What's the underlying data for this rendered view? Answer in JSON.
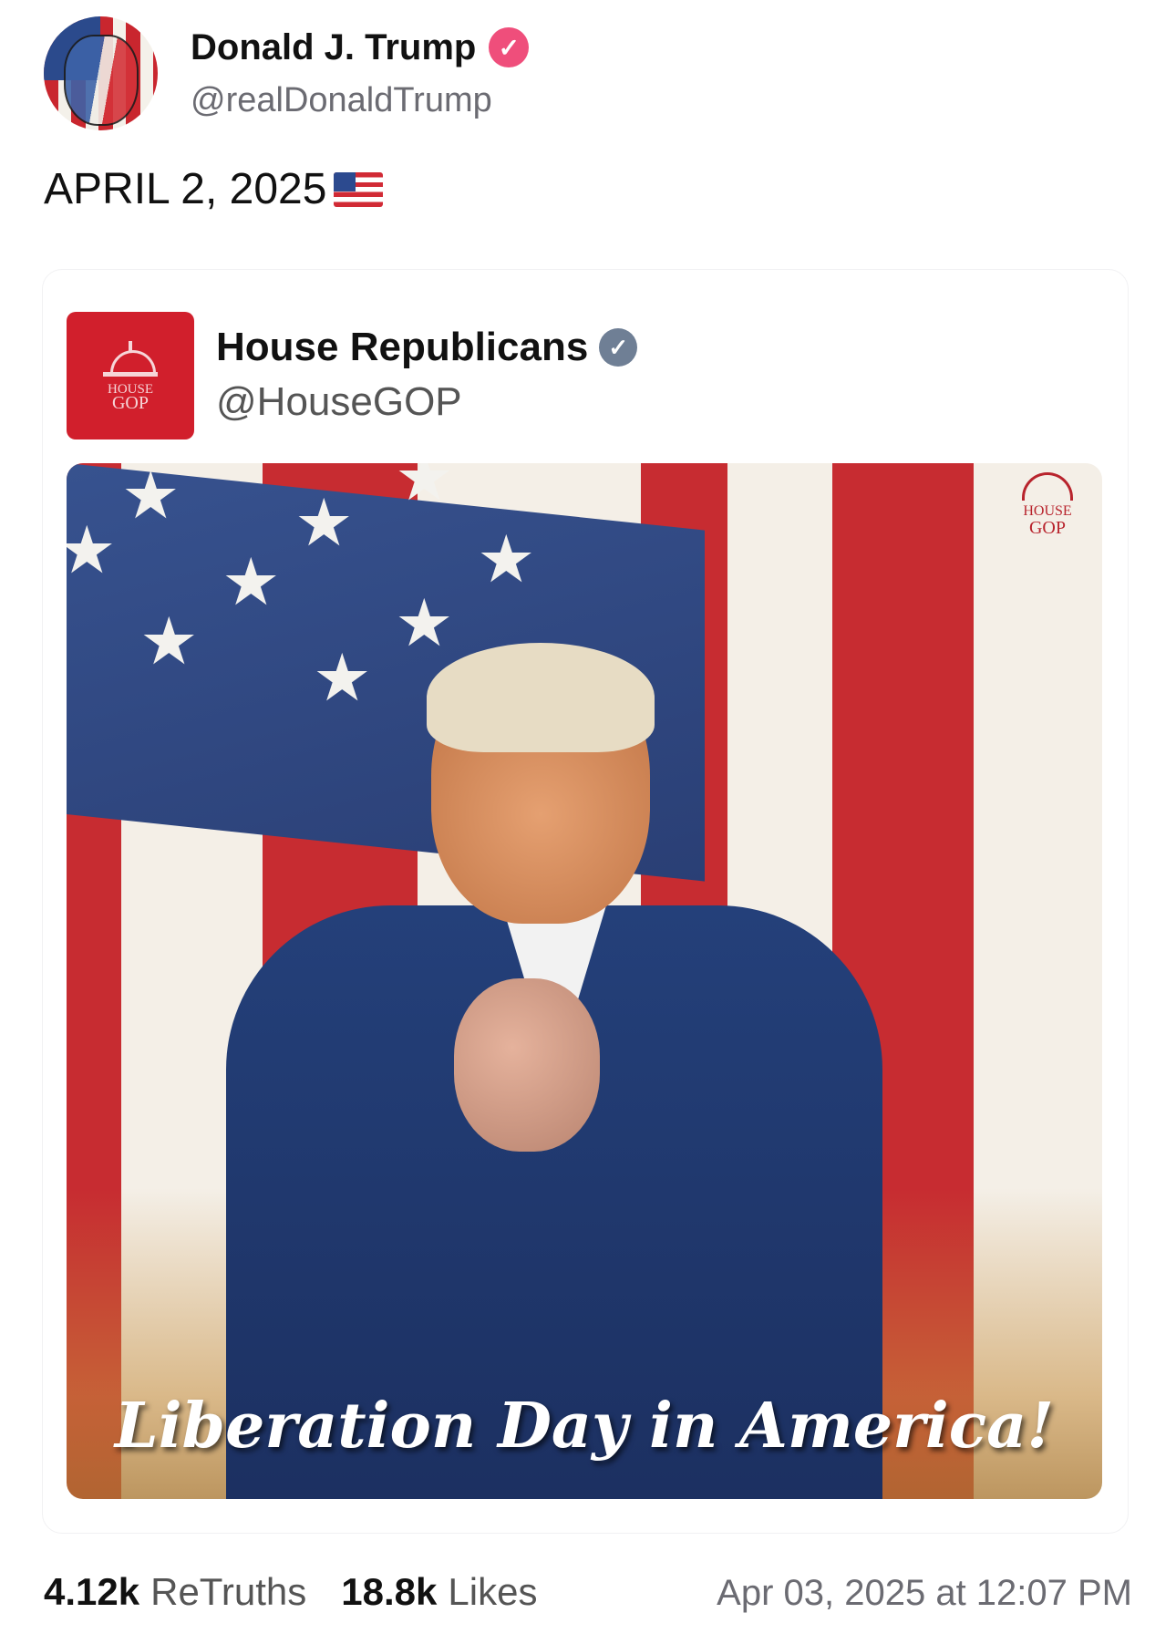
{
  "author": {
    "display_name": "Donald J. Trump",
    "handle": "@realDonaldTrump",
    "verified_icon": "verified-badge-icon"
  },
  "post": {
    "text": "APRIL 2, 2025",
    "emoji": "us-flag-emoji"
  },
  "quoted": {
    "display_name": "House Republicans",
    "handle": "@HouseGOP",
    "logo_text_top": "HOUSE",
    "logo_text_bottom": "GOP",
    "media_caption": "Liberation Day in America!",
    "watermark_top": "HOUSE",
    "watermark_bottom": "GOP"
  },
  "stats": {
    "retruths_count": "4.12k",
    "retruths_label": "ReTruths",
    "likes_count": "18.8k",
    "likes_label": "Likes",
    "timestamp": "Apr 03, 2025 at 12:07 PM"
  },
  "colors": {
    "verified_pink": "#ef4e7b",
    "verified_gray": "#6f7f95",
    "gop_red": "#d11f2c"
  }
}
